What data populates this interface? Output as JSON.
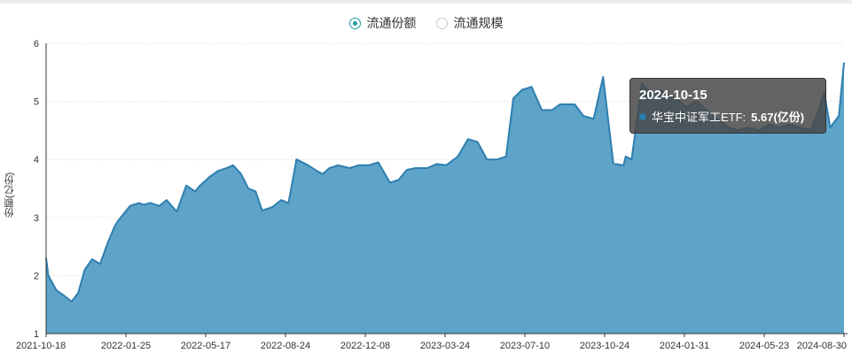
{
  "legend": {
    "items": [
      {
        "label": "流通份额",
        "checked": true
      },
      {
        "label": "流通规模",
        "checked": false
      }
    ]
  },
  "tooltip": {
    "date": "2024-10-15",
    "series_label": "华宝中证军工ETF:",
    "value": "5.67(亿份)"
  },
  "colors": {
    "line": "#2e7fb0",
    "fill": "#5ea3c8",
    "accent": "#1a9aa7"
  },
  "chart_data": {
    "type": "area",
    "ylabel": "份额(亿份)",
    "ylim": [
      1,
      6
    ],
    "yticks": [
      1,
      2,
      3,
      4,
      5,
      6
    ],
    "xtick_labels": [
      "2021-10-18",
      "2022-01-25",
      "2022-05-17",
      "2022-08-24",
      "2022-12-08",
      "2023-03-24",
      "2023-07-10",
      "2023-10-24",
      "2024-01-31",
      "2024-05-23",
      "2024-08-30"
    ],
    "grid": "horizontal",
    "series": [
      {
        "name": "华宝中证军工ETF",
        "x": [
          "2021-10-18",
          "2021-10-21",
          "2021-11-01",
          "2021-11-12",
          "2021-11-22",
          "2021-12-01",
          "2021-12-10",
          "2021-12-20",
          "2021-12-31",
          "2022-01-10",
          "2022-01-20",
          "2022-01-25",
          "2022-02-10",
          "2022-02-22",
          "2022-03-01",
          "2022-03-10",
          "2022-03-22",
          "2022-04-01",
          "2022-04-15",
          "2022-04-28",
          "2022-05-10",
          "2022-05-17",
          "2022-05-30",
          "2022-06-10",
          "2022-06-22",
          "2022-07-01",
          "2022-07-12",
          "2022-07-22",
          "2022-08-01",
          "2022-08-10",
          "2022-08-24",
          "2022-09-05",
          "2022-09-15",
          "2022-09-26",
          "2022-10-12",
          "2022-10-24",
          "2022-11-01",
          "2022-11-10",
          "2022-11-22",
          "2022-12-08",
          "2022-12-20",
          "2023-01-03",
          "2023-01-16",
          "2023-02-01",
          "2023-02-13",
          "2023-02-24",
          "2023-03-08",
          "2023-03-24",
          "2023-04-06",
          "2023-04-19",
          "2023-05-05",
          "2023-05-19",
          "2023-06-01",
          "2023-06-14",
          "2023-06-28",
          "2023-07-10",
          "2023-07-20",
          "2023-08-01",
          "2023-08-14",
          "2023-08-28",
          "2023-09-11",
          "2023-09-22",
          "2023-10-12",
          "2023-10-24",
          "2023-11-07",
          "2023-11-20",
          "2023-12-04",
          "2023-12-18",
          "2023-12-21",
          "2023-12-29",
          "2024-01-12",
          "2024-01-24",
          "2024-01-31",
          "2024-02-06",
          "2024-02-28",
          "2024-03-13",
          "2024-03-27",
          "2024-04-10",
          "2024-04-24",
          "2024-05-10",
          "2024-05-23",
          "2024-06-06",
          "2024-06-20",
          "2024-07-04",
          "2024-07-18",
          "2024-08-01",
          "2024-08-15",
          "2024-08-30",
          "2024-09-09",
          "2024-09-18",
          "2024-09-26",
          "2024-10-08",
          "2024-10-15"
        ],
        "values": [
          2.3,
          2.0,
          1.75,
          1.65,
          1.55,
          1.7,
          2.1,
          2.28,
          2.2,
          2.55,
          2.85,
          2.95,
          3.2,
          3.25,
          3.22,
          3.25,
          3.2,
          3.3,
          3.1,
          3.55,
          3.45,
          3.55,
          3.7,
          3.8,
          3.85,
          3.9,
          3.75,
          3.5,
          3.45,
          3.12,
          3.18,
          3.3,
          3.25,
          4.0,
          3.9,
          3.8,
          3.75,
          3.85,
          3.9,
          3.85,
          3.9,
          3.9,
          3.95,
          3.6,
          3.65,
          3.82,
          3.85,
          3.85,
          3.92,
          3.9,
          4.05,
          4.35,
          4.3,
          4.0,
          4.0,
          4.05,
          5.05,
          5.2,
          5.25,
          4.85,
          4.85,
          4.95,
          4.95,
          4.75,
          4.7,
          5.42,
          3.93,
          3.9,
          4.05,
          4.0,
          5.3,
          5.15,
          5.1,
          5.2,
          5.05,
          4.9,
          5.0,
          4.85,
          4.7,
          4.55,
          4.5,
          4.55,
          4.5,
          4.6,
          4.55,
          4.6,
          4.55,
          4.5,
          4.8,
          5.15,
          4.55,
          4.75,
          5.67
        ]
      }
    ]
  }
}
